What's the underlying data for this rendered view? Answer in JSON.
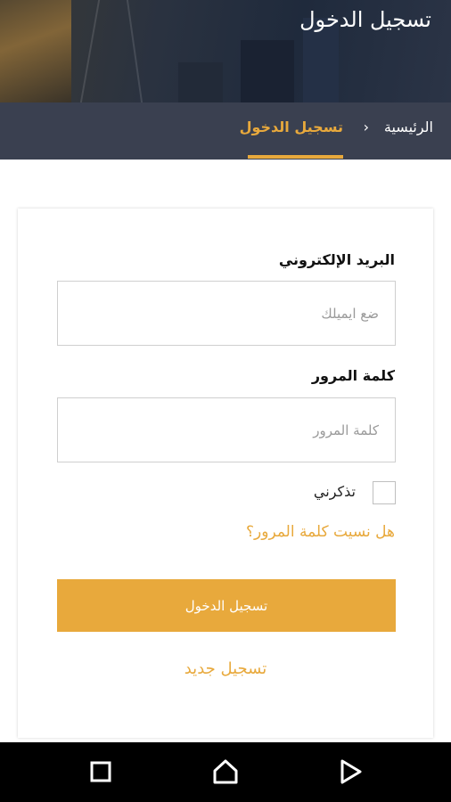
{
  "header": {
    "title": "تسجيل الدخول"
  },
  "breadcrumb": {
    "home": "الرئيسية",
    "separator": "›",
    "current": "تسجيل الدخول"
  },
  "form": {
    "email_label": "البريد الإلكتروني",
    "email_placeholder": "ضع ايميلك",
    "email_value": "",
    "password_label": "كلمة المرور",
    "password_placeholder": "كلمة المرور",
    "password_value": "",
    "remember_label": "تذكرني",
    "remember_checked": false,
    "forgot_link": "هل نسيت كلمة المرور؟",
    "submit_label": "تسجيل الدخول",
    "register_link": "تسجيل جديد"
  },
  "navbar": {
    "icons": [
      "recent-apps-icon",
      "home-icon",
      "back-icon"
    ]
  },
  "colors": {
    "accent": "#e8a93c",
    "breadcrumb_bg": "#3a4050",
    "navbar_bg": "#000000"
  }
}
